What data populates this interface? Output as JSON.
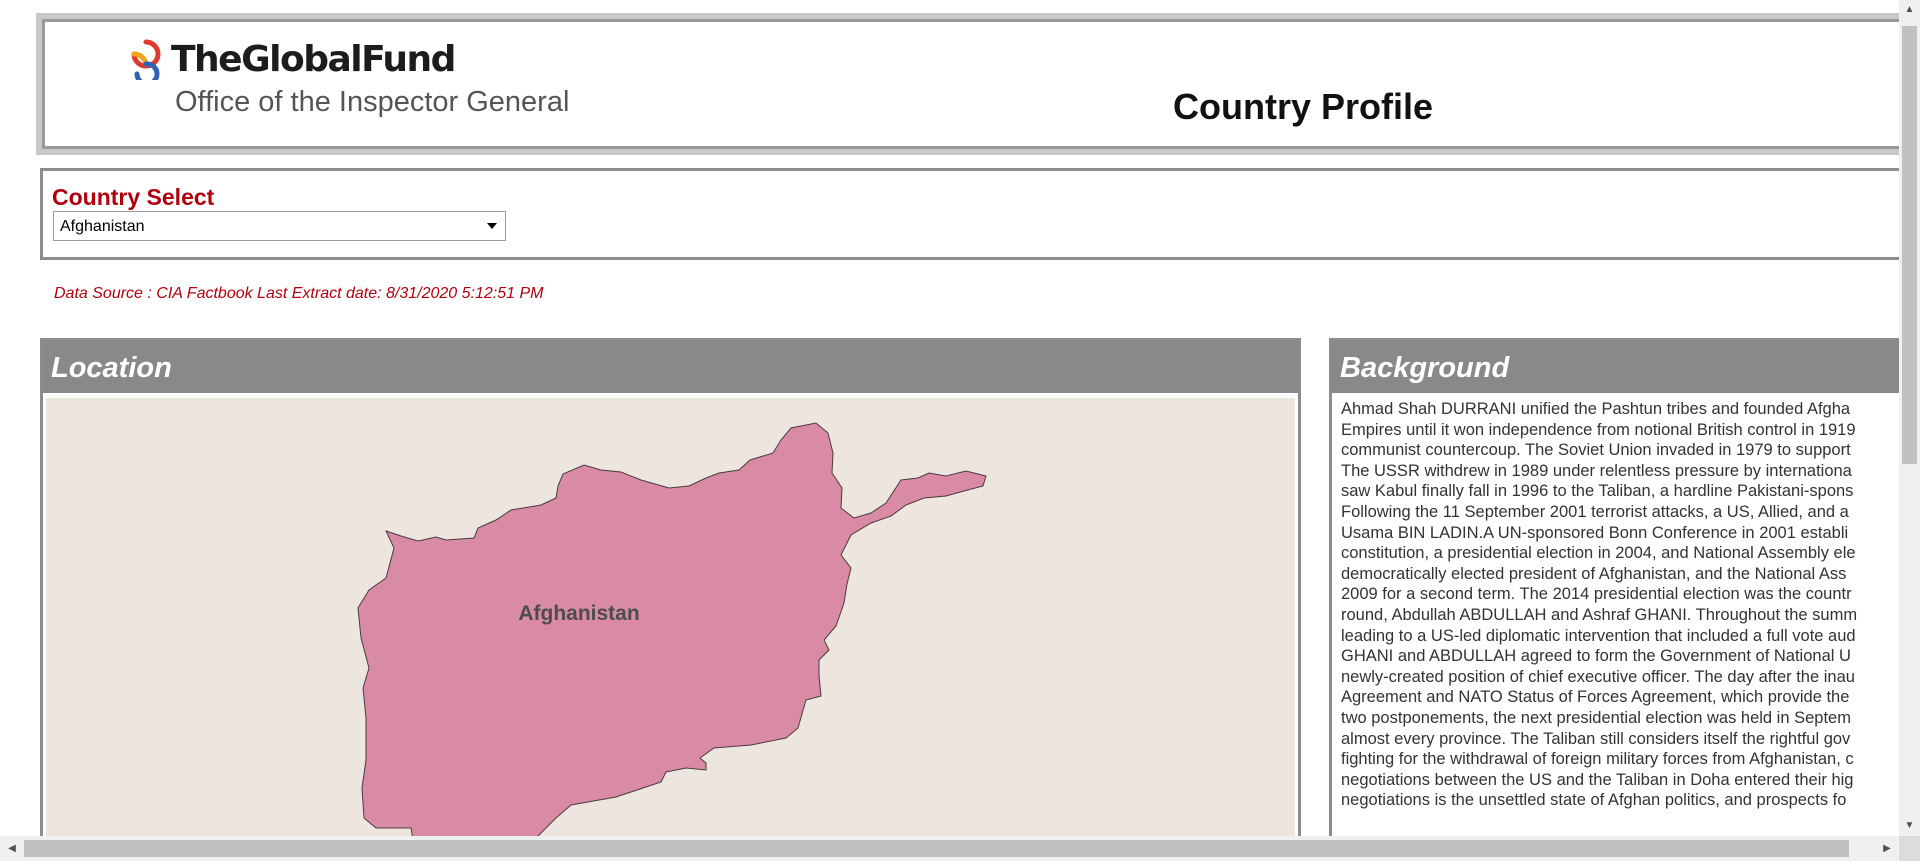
{
  "header": {
    "brand_name": "TheGlobalFund",
    "brand_subtitle": "Office of the Inspector General",
    "title": "Country Profile"
  },
  "country_select": {
    "label": "Country Select",
    "selected": "Afghanistan"
  },
  "data_source": "Data Source : CIA Factbook  Last Extract date: 8/31/2020 5:12:51 PM",
  "location": {
    "title": "Location",
    "map_label": "Afghanistan"
  },
  "background": {
    "title": "Background",
    "lines": [
      "Ahmad Shah DURRANI unified the Pashtun tribes and founded Afgha",
      "Empires until it won independence from notional British control in 1919",
      "communist countercoup. The Soviet Union invaded in 1979 to support",
      "The USSR withdrew in 1989 under relentless pressure by internationa",
      "saw Kabul finally fall in 1996 to the Taliban, a hardline Pakistani-spons",
      "Following the 11 September 2001 terrorist attacks, a US, Allied, and a",
      "Usama BIN LADIN.A UN-sponsored Bonn Conference in 2001 establi",
      "constitution, a presidential election in 2004, and National Assembly ele",
      "democratically elected president of Afghanistan, and the National Ass",
      "2009 for a second term. The 2014 presidential election was the countr",
      "round, Abdullah ABDULLAH and Ashraf GHANI. Throughout the summ",
      "leading to a US-led diplomatic intervention that included a full vote aud",
      "GHANI and ABDULLAH agreed to form the Government of National U",
      "newly-created position of chief executive officer. The day after the inau",
      "Agreement and NATO Status of Forces Agreement, which provide the",
      "two postponements, the next presidential election was held in Septem",
      "almost every province. The Taliban still considers itself the rightful gov",
      "fighting for the withdrawal of foreign military forces from Afghanistan, c",
      "negotiations between the US and the Taliban in Doha entered their hig",
      "negotiations is the unsettled state of Afghan politics, and prospects fo"
    ]
  },
  "colors": {
    "accent_red": "#b0000e",
    "panel_header": "#898989",
    "map_land": "#d98ba5",
    "map_background": "#ede6df"
  }
}
